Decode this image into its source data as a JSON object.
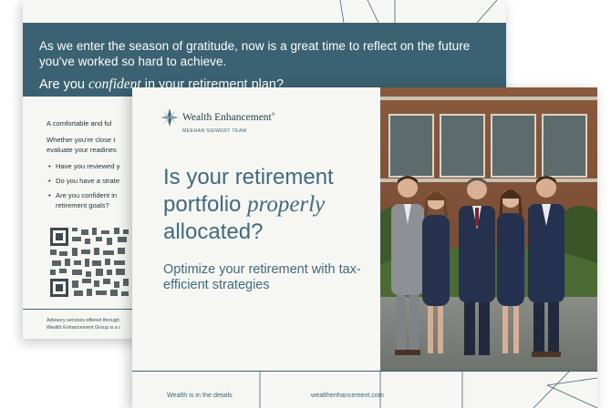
{
  "back_card": {
    "intro_text": "As we enter the season of gratitude, now is a great time to reflect on the future you've worked so hard to achieve.",
    "question_prefix": "Are you",
    "question_emphasis": "confident",
    "question_suffix": "in your retirement plan?",
    "body_heading": "A comfortable and ful",
    "body_para_line1": "Whether you're close t",
    "body_para_line2": "evaluate your readines",
    "bullets": [
      {
        "line1": "Have you reviewed y",
        "line2": ""
      },
      {
        "line1": "Do you have a strate",
        "line2": ""
      },
      {
        "line1": "Are you confident in",
        "line2": "retirement goals?"
      }
    ],
    "disclosure_line1": "Advisory services offered through",
    "disclosure_line2": "Wealth Enhancement Group is a r"
  },
  "front_card": {
    "brand_name": "Wealth Enhancement",
    "brand_mark": "®",
    "team_name": "MEEHAN SIEWERT TEAM",
    "headline_part1": "Is your retirement",
    "headline_part2": "portfolio",
    "headline_emphasis": "properly",
    "headline_part3": "allocated?",
    "subhead": "Optimize your retirement with tax-efficient strategies",
    "footer_tagline": "Wealth is in the details",
    "footer_url": "wealthenhancement.com"
  },
  "colors": {
    "band_teal": "#3b6272",
    "headline_blue": "#3f6a80",
    "card_cream": "#f6f7f3"
  },
  "icons": {
    "logo": "star-compass-icon",
    "qr": "qr-code-icon"
  }
}
